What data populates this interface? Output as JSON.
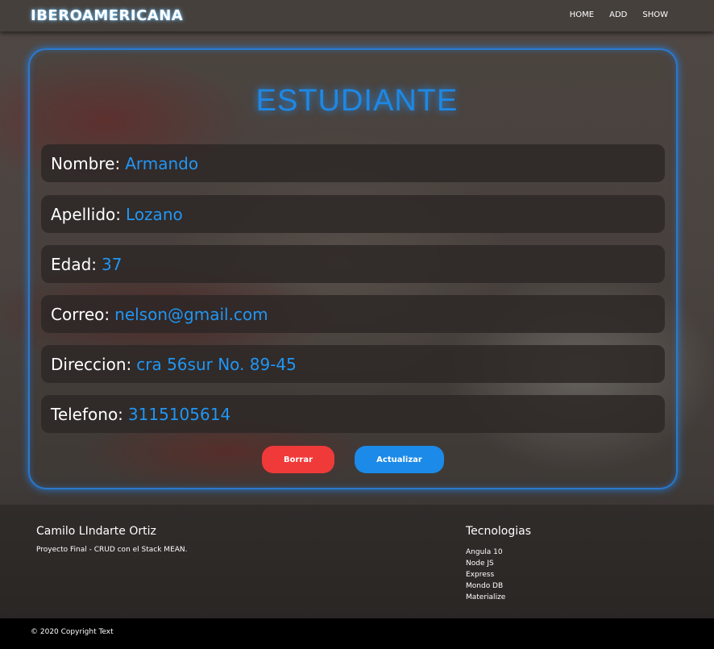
{
  "navbar": {
    "brand": "IBEROAMERICANA",
    "links": [
      "HOME",
      "ADD",
      "SHOW"
    ]
  },
  "card": {
    "title": "ESTUDIANTE",
    "fields": [
      {
        "label": "Nombre:",
        "value": "Armando"
      },
      {
        "label": "Apellido:",
        "value": "Lozano"
      },
      {
        "label": "Edad:",
        "value": "37"
      },
      {
        "label": "Correo:",
        "value": "nelson@gmail.com"
      },
      {
        "label": "Direccion:",
        "value": "cra 56sur No. 89-45"
      },
      {
        "label": "Telefono:",
        "value": "3115105614"
      }
    ],
    "buttons": {
      "delete": "Borrar",
      "update": "Actualizar"
    }
  },
  "footer": {
    "author": "Camilo LIndarte Ortiz",
    "description": "Proyecto Final - CRUD con el Stack MEAN.",
    "tech_title": "Tecnologias",
    "tech_items": [
      "Angula 10",
      "Node JS",
      "Express",
      "Mondo DB",
      "Materialize"
    ],
    "copyright": "© 2020 Copyright Text"
  },
  "colors": {
    "accent": "#1e88e5",
    "delete_button": "#f03a3a",
    "update_button": "#1b8ae8"
  }
}
